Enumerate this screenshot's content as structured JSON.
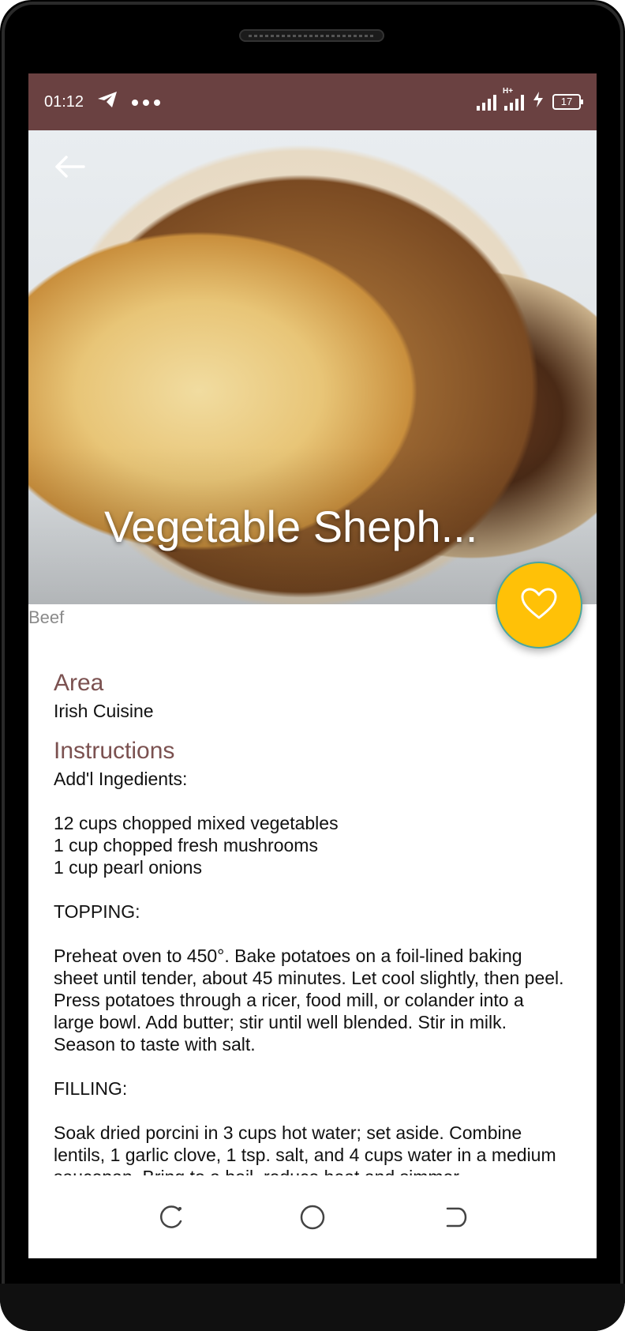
{
  "colors": {
    "status_bar": "#6a4141",
    "accent_title": "#7b5150",
    "fab": "#ffc107"
  },
  "status_bar": {
    "time": "01:12",
    "icons": [
      "telegram-icon",
      "more-dots-icon",
      "signal-icon",
      "signal-hplus-icon",
      "charging-icon"
    ],
    "battery": "17"
  },
  "hero": {
    "title": "Vegetable Sheph...",
    "back_icon": "arrow-left-icon"
  },
  "fab": {
    "icon": "heart-outline-icon"
  },
  "category": "Beef",
  "area": {
    "label": "Area",
    "value": "Irish Cuisine"
  },
  "instructions": {
    "label": "Instructions",
    "text": "Add'l Ingedients:\n\n12 cups chopped mixed vegetables\n1   cup chopped fresh mushrooms\n1   cup pearl onions\n\nTOPPING:\n\nPreheat oven to 450°. Bake potatoes on a foil-lined baking sheet until tender, about 45 minutes. Let cool slightly, then peel. Press potatoes through a ricer, food mill, or colander into a large bowl. Add butter; stir until well blended. Stir in milk. Season to taste with salt.\n\nFILLING:\n\nSoak dried porcini in 3 cups hot water; set aside. Combine lentils, 1 garlic clove, 1 tsp. salt, and 4 cups water in a medium saucepan. Bring to a boil, reduce heat and simmer"
  },
  "nav": {
    "icons": [
      "recents-icon",
      "home-circle-icon",
      "back-icon"
    ]
  }
}
